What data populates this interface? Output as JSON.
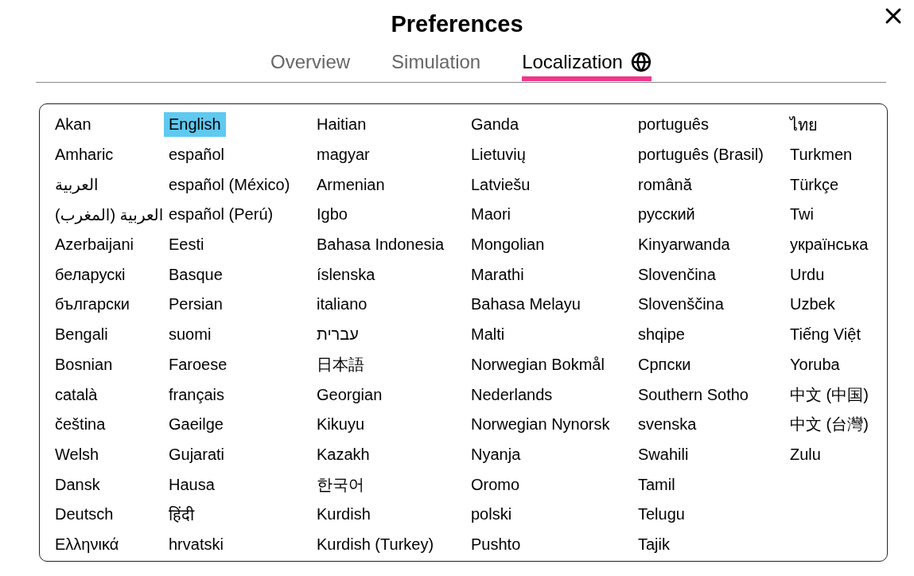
{
  "window": {
    "title": "Preferences"
  },
  "tabs": [
    {
      "label": "Overview",
      "selected": false
    },
    {
      "label": "Simulation",
      "selected": false
    },
    {
      "label": "Localization",
      "selected": true
    }
  ],
  "languages": [
    {
      "label": "Akan",
      "selected": false
    },
    {
      "label": "Amharic",
      "selected": false
    },
    {
      "label": "العربية",
      "selected": false
    },
    {
      "label": "العربية (المغرب)",
      "selected": false
    },
    {
      "label": "Azerbaijani",
      "selected": false
    },
    {
      "label": "беларускі",
      "selected": false
    },
    {
      "label": "български",
      "selected": false
    },
    {
      "label": "Bengali",
      "selected": false
    },
    {
      "label": "Bosnian",
      "selected": false
    },
    {
      "label": "català",
      "selected": false
    },
    {
      "label": "čeština",
      "selected": false
    },
    {
      "label": "Welsh",
      "selected": false
    },
    {
      "label": "Dansk",
      "selected": false
    },
    {
      "label": "Deutsch",
      "selected": false
    },
    {
      "label": "Ελληνικά",
      "selected": false
    },
    {
      "label": "English",
      "selected": true
    },
    {
      "label": "español",
      "selected": false
    },
    {
      "label": "español (México)",
      "selected": false
    },
    {
      "label": "español (Perú)",
      "selected": false
    },
    {
      "label": "Eesti",
      "selected": false
    },
    {
      "label": "Basque",
      "selected": false
    },
    {
      "label": "Persian",
      "selected": false
    },
    {
      "label": "suomi",
      "selected": false
    },
    {
      "label": "Faroese",
      "selected": false
    },
    {
      "label": "français",
      "selected": false
    },
    {
      "label": "Gaeilge",
      "selected": false
    },
    {
      "label": "Gujarati",
      "selected": false
    },
    {
      "label": "Hausa",
      "selected": false
    },
    {
      "label": "हिंदी",
      "selected": false
    },
    {
      "label": "hrvatski",
      "selected": false
    },
    {
      "label": "Haitian",
      "selected": false
    },
    {
      "label": "magyar",
      "selected": false
    },
    {
      "label": "Armenian",
      "selected": false
    },
    {
      "label": "Igbo",
      "selected": false
    },
    {
      "label": "Bahasa Indonesia",
      "selected": false
    },
    {
      "label": "íslenska",
      "selected": false
    },
    {
      "label": "italiano",
      "selected": false
    },
    {
      "label": "עברית",
      "selected": false
    },
    {
      "label": "日本語",
      "selected": false
    },
    {
      "label": "Georgian",
      "selected": false
    },
    {
      "label": "Kikuyu",
      "selected": false
    },
    {
      "label": "Kazakh",
      "selected": false
    },
    {
      "label": "한국어",
      "selected": false
    },
    {
      "label": "Kurdish",
      "selected": false
    },
    {
      "label": "Kurdish (Turkey)",
      "selected": false
    },
    {
      "label": "Ganda",
      "selected": false
    },
    {
      "label": "Lietuvių",
      "selected": false
    },
    {
      "label": "Latviešu",
      "selected": false
    },
    {
      "label": "Maori",
      "selected": false
    },
    {
      "label": "Mongolian",
      "selected": false
    },
    {
      "label": "Marathi",
      "selected": false
    },
    {
      "label": "Bahasa Melayu",
      "selected": false
    },
    {
      "label": "Malti",
      "selected": false
    },
    {
      "label": "Norwegian Bokmål",
      "selected": false
    },
    {
      "label": "Nederlands",
      "selected": false
    },
    {
      "label": "Norwegian Nynorsk",
      "selected": false
    },
    {
      "label": "Nyanja",
      "selected": false
    },
    {
      "label": "Oromo",
      "selected": false
    },
    {
      "label": "polski",
      "selected": false
    },
    {
      "label": "Pushto",
      "selected": false
    },
    {
      "label": "português",
      "selected": false
    },
    {
      "label": "português (Brasil)",
      "selected": false
    },
    {
      "label": "română",
      "selected": false
    },
    {
      "label": "русский",
      "selected": false
    },
    {
      "label": "Kinyarwanda",
      "selected": false
    },
    {
      "label": "Slovenčina",
      "selected": false
    },
    {
      "label": "Slovenščina",
      "selected": false
    },
    {
      "label": "shqipe",
      "selected": false
    },
    {
      "label": "Српски",
      "selected": false
    },
    {
      "label": "Southern Sotho",
      "selected": false
    },
    {
      "label": "svenska",
      "selected": false
    },
    {
      "label": "Swahili",
      "selected": false
    },
    {
      "label": "Tamil",
      "selected": false
    },
    {
      "label": "Telugu",
      "selected": false
    },
    {
      "label": "Tajik",
      "selected": false
    },
    {
      "label": "ไทย",
      "selected": false
    },
    {
      "label": "Turkmen",
      "selected": false
    },
    {
      "label": "Türkçe",
      "selected": false
    },
    {
      "label": "Twi",
      "selected": false
    },
    {
      "label": "українська",
      "selected": false
    },
    {
      "label": "Urdu",
      "selected": false
    },
    {
      "label": "Uzbek",
      "selected": false
    },
    {
      "label": "Tiếng Việt",
      "selected": false
    },
    {
      "label": "Yoruba",
      "selected": false
    },
    {
      "label": "中文 (中国)",
      "selected": false
    },
    {
      "label": "中文 (台灣)",
      "selected": false
    },
    {
      "label": "Zulu",
      "selected": false
    }
  ]
}
